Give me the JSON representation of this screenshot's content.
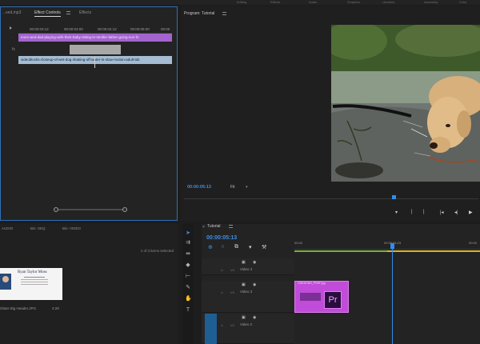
{
  "top_menu": [
    "Editing",
    "Effects",
    "Audio",
    "Graphics",
    "Libraries",
    "Assembly",
    "Color"
  ],
  "effect_controls": {
    "tabs": [
      "...ved.mp3",
      "Effect Controls",
      "Effects"
    ],
    "timecodes": [
      "00:00:03:12",
      "00:00:04:00",
      "00:00:04:12",
      "00:00:05:00",
      "00:00"
    ],
    "clip_1": "mom-and-dad-playing-with-their-baby-sitting-in-stroller-father-going-son-fo",
    "clip_2": "videoblocks-closeup-of-wet-dog-shaking-off-water-in-slow-motion-adult-lab",
    "fx_label": "fx"
  },
  "program": {
    "title": "Program: Tutorial",
    "timecode": "00:00:05:13",
    "fit": "Fit"
  },
  "project": {
    "tabs": [
      "AUDIO",
      "Bin: SEQ",
      "Bin: VIDEO"
    ],
    "items_selected": "1 of 3 items selected",
    "thumb_title": "Ryan Taylor Moss",
    "thumb_name": "Glass Big Header.JPG",
    "thumb_duration": "4:29"
  },
  "timeline": {
    "title": "Tutorial",
    "timecode": "00:00:05:13",
    "ruler": [
      "00:00",
      "00:00:04:23",
      "00:00"
    ],
    "tracks": [
      "Video 4",
      "Video 3",
      "Video 2"
    ],
    "track_ids": [
      "V4",
      "V3",
      "V2"
    ],
    "clip_name": "GREATING_PREF.jpg",
    "clip_logo": "Pr"
  },
  "colors": {
    "accent_blue": "#2f8df0",
    "clip_purple": "#c14cd9",
    "work_area_green": "#76b041"
  }
}
